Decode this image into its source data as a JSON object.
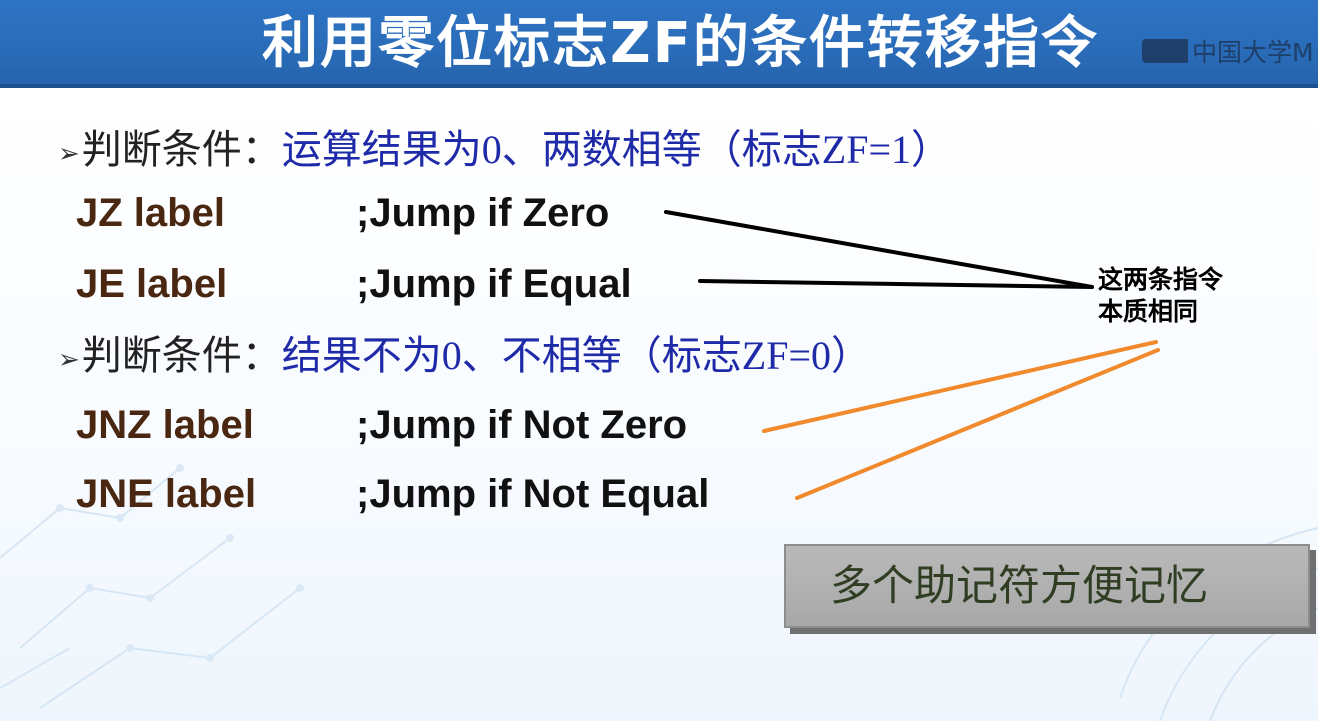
{
  "title": "利用零位标志ZF的条件转移指令",
  "logo_text": "中国大学M",
  "conditions": [
    {
      "bullet": "➢",
      "prefix": "判断条件：",
      "desc": "运算结果为0、两数相等（标志ZF=1）"
    },
    {
      "bullet": "➢",
      "prefix": "判断条件：",
      "desc": "结果不为0、不相等（标志ZF=0）"
    }
  ],
  "instructions": [
    {
      "op": "JZ label",
      "comment": ";Jump if Zero"
    },
    {
      "op": "JE label",
      "comment": ";Jump if Equal"
    },
    {
      "op": "JNZ label",
      "comment": ";Jump if Not Zero"
    },
    {
      "op": "JNE label",
      "comment": ";Jump if Not Equal"
    }
  ],
  "note": {
    "line1": "这两条指令",
    "line2": "本质相同"
  },
  "callout": "多个助记符方便记忆",
  "colors": {
    "title_bar": "#2a6cb9",
    "condition_text": "#1f2aa8",
    "opcode_text": "#4a2710",
    "connector_black": "#000000",
    "connector_orange": "#f08a2c",
    "callout_bg": "#b0b0b0"
  }
}
